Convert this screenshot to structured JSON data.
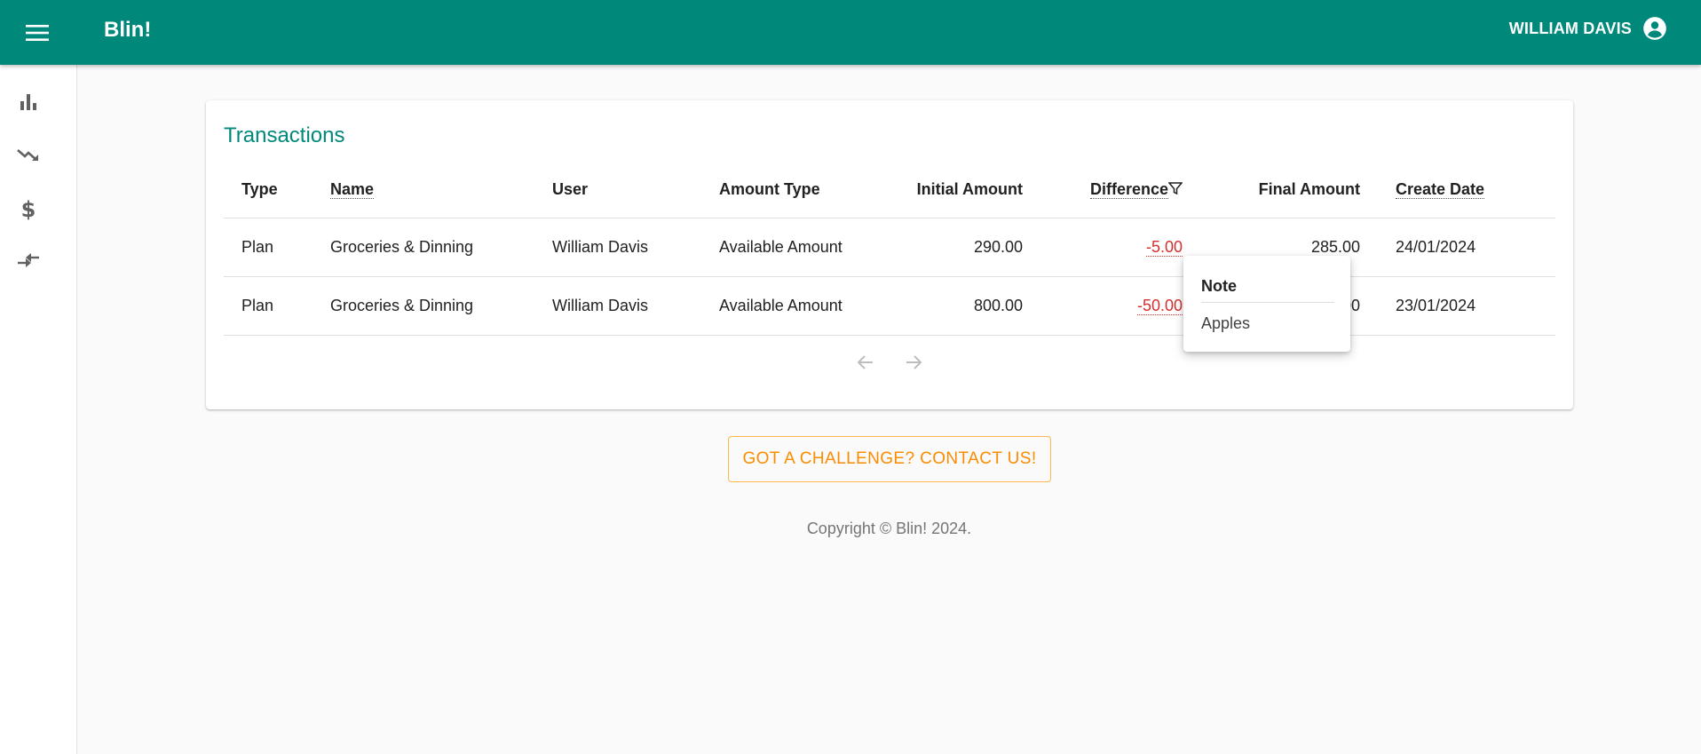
{
  "header": {
    "app_title": "Blin!",
    "user_name": "WILLIAM DAVIS"
  },
  "sidebar": {
    "items": [
      {
        "icon": "bar-chart-icon"
      },
      {
        "icon": "trending-down-icon"
      },
      {
        "icon": "dollar-icon"
      },
      {
        "icon": "compare-arrows-icon"
      }
    ]
  },
  "card": {
    "title": "Transactions",
    "columns": {
      "type": "Type",
      "name": "Name",
      "user": "User",
      "amount_type": "Amount Type",
      "initial_amount": "Initial Amount",
      "difference": "Difference",
      "final_amount": "Final Amount",
      "create_date": "Create Date"
    },
    "rows": [
      {
        "type": "Plan",
        "name": "Groceries & Dinning",
        "user": "William Davis",
        "amount_type": "Available Amount",
        "initial_amount": "290.00",
        "difference": "-5.00",
        "final_amount": "285.00",
        "create_date": "24/01/2024"
      },
      {
        "type": "Plan",
        "name": "Groceries & Dinning",
        "user": "William Davis",
        "amount_type": "Available Amount",
        "initial_amount": "800.00",
        "difference": "-50.00",
        "final_amount": "750.00",
        "create_date": "23/01/2024"
      }
    ]
  },
  "popover": {
    "title": "Note",
    "body": "Apples"
  },
  "contact_button": "GOT A CHALLENGE? CONTACT US!",
  "footer": "Copyright © Blin! 2024.",
  "colors": {
    "primary": "#00897b",
    "negative": "#d32f2f",
    "accent": "#fb8c00"
  }
}
